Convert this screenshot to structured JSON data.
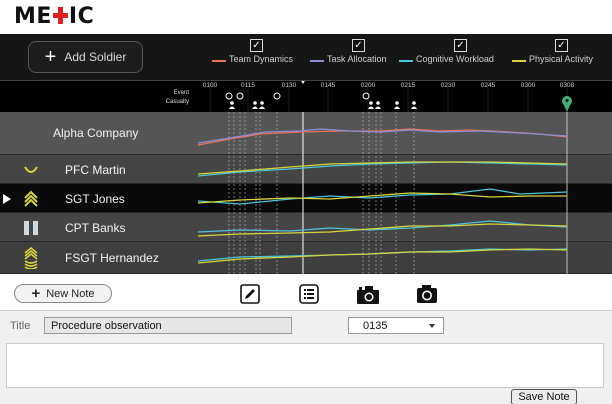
{
  "app": {
    "logo_left": "ME",
    "logo_right": "IC",
    "logo_cross_icon": "red-cross"
  },
  "toolbar": {
    "add_soldier_label": "Add Soldier",
    "metrics": [
      {
        "label": "Team Dynamics",
        "color": "#e8735a",
        "checked": true
      },
      {
        "label": "Task Allocation",
        "color": "#8a8fd6",
        "checked": true
      },
      {
        "label": "Cognitive Workload",
        "color": "#4fc3d9",
        "checked": true
      },
      {
        "label": "Physical Activity",
        "color": "#d6d43c",
        "checked": true
      }
    ]
  },
  "timeline": {
    "event_label": "Event",
    "casualty_label": "Casualty",
    "ticks": [
      "0100",
      "0115",
      "0130",
      "0145",
      "0200",
      "0215",
      "0230",
      "0245",
      "0300",
      "0308"
    ]
  },
  "rows": [
    {
      "name": "Alpha Company",
      "rank_icon": ""
    },
    {
      "name": "PFC Martin",
      "rank_icon": "pfc-rank-icon"
    },
    {
      "name": "SGT Jones",
      "rank_icon": "sgt-rank-icon"
    },
    {
      "name": "CPT Banks",
      "rank_icon": "cpt-rank-icon"
    },
    {
      "name": "FSGT Hernandez",
      "rank_icon": "fsgt-rank-icon"
    }
  ],
  "notes": {
    "new_note_label": "New Note",
    "title_label": "Title",
    "title_value": "Procedure observation",
    "time_value": "0135",
    "save_label": "Save Note"
  }
}
